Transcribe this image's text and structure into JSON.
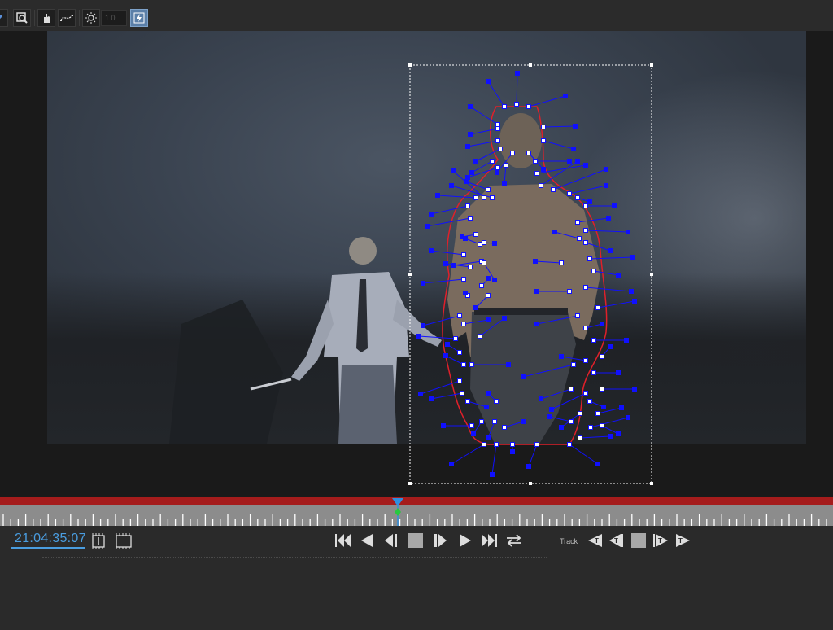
{
  "toolbar": {
    "icons": [
      "pen-icon",
      "zoom-region-icon",
      "hand-tool-icon",
      "bezier-curve-icon",
      "brightness-icon",
      "lightning-icon"
    ],
    "brightness_value": "1.0"
  },
  "viewer": {
    "scene": "video frame with tracking mask",
    "mask_color": "#1010ff",
    "mask_outline_color": "#e0202a",
    "selection_box_color": "#ffffff"
  },
  "timeline": {
    "range_color": "#a51c1c",
    "playhead_color": "#2f8fe0",
    "keyframe_color": "#28c840"
  },
  "controls": {
    "timecode": "21:04:35:07",
    "track_label": "Track",
    "transport_icons": [
      "go-to-start-icon",
      "play-reverse-icon",
      "step-back-icon",
      "stop-icon",
      "step-forward-icon",
      "play-icon",
      "go-to-end-icon",
      "loop-icon"
    ],
    "track_icons": [
      "track-backward-icon",
      "track-step-backward-icon",
      "track-stop-icon",
      "track-step-forward-icon",
      "track-forward-icon"
    ]
  }
}
